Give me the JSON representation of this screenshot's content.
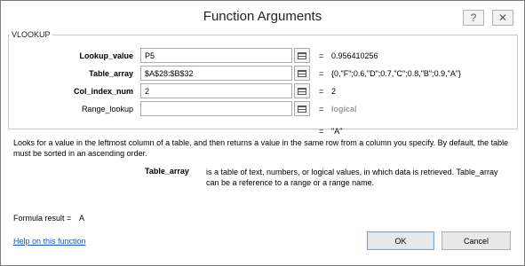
{
  "dialog": {
    "title": "Function Arguments",
    "help_glyph": "?",
    "close_glyph": "✕"
  },
  "function_name": "VLOOKUP",
  "arguments": [
    {
      "label": "Lookup_value",
      "bold": true,
      "value": "P5",
      "result": "0.956410256",
      "result_muted": false
    },
    {
      "label": "Table_array",
      "bold": true,
      "value": "$A$28:$B$32",
      "result": "{0,\"F\";0.6,\"D\";0.7,\"C\";0.8,\"B\";0.9,\"A\"}",
      "result_muted": false
    },
    {
      "label": "Col_index_num",
      "bold": true,
      "value": "2",
      "result": "2",
      "result_muted": false
    },
    {
      "label": "Range_lookup",
      "bold": false,
      "value": "",
      "result": "logical",
      "result_muted": true
    }
  ],
  "equals_sign": "=",
  "function_result": "\"A\"",
  "description": "Looks for a value in the leftmost column of a table, and then returns a value in the same row from a column you specify. By default, the table must be sorted in an ascending order.",
  "parameter_help": {
    "name": "Table_array",
    "text": "is a table of text, numbers, or logical values, in which data is retrieved. Table_array can be a reference to a range or a range name."
  },
  "formula_result": {
    "label": "Formula result =",
    "value": "A"
  },
  "help_link": "Help on this function",
  "buttons": {
    "ok": "OK",
    "cancel": "Cancel"
  },
  "colors": {
    "link": "#1a56b6",
    "muted_value": "#9a9a9a",
    "ok_border": "#7ba3d8"
  },
  "icons": [
    "help-icon",
    "close-icon",
    "range-selector-icon"
  ]
}
